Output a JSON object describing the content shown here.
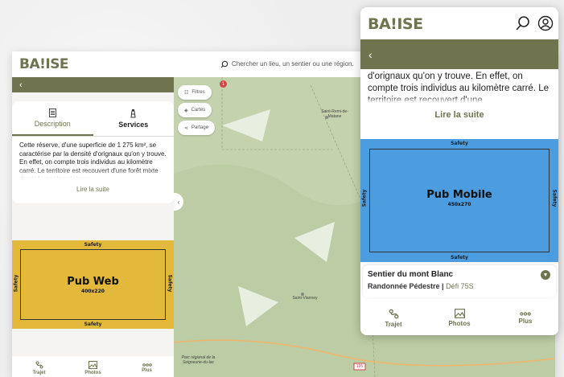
{
  "brand": {
    "logo": "BA!ISE",
    "olive": "#6f744f"
  },
  "desktop": {
    "search_placeholder": "Chercher un lieu, un sentier ou une région...",
    "panel": {
      "back": "‹",
      "tabs": [
        {
          "label": "Description",
          "icon": "document-icon"
        },
        {
          "label": "Services",
          "icon": "lighthouse-icon"
        }
      ],
      "description": "Cette réserve, d'une superficie de 1 275 km², se caractérise par la densité d'orignaux qu'on y trouve. En effet, on compte trois individus au kilomètre carré. Le territoire est recouvert d'une forêt mixte dominée par les résineux.",
      "read_more": "Lire la suite"
    },
    "ad": {
      "title": "Pub Web",
      "size": "400x220",
      "safety": "Safety",
      "color": "#e2b93a"
    },
    "nav": [
      {
        "label": "Trajet",
        "icon": "route-icon"
      },
      {
        "label": "Photos",
        "icon": "image-icon"
      },
      {
        "label": "Plus",
        "icon": "more-icon"
      }
    ],
    "map": {
      "chips": [
        {
          "label": "Filtres",
          "icon": "filter-icon",
          "badge": "1"
        },
        {
          "label": "Cartes",
          "icon": "layers-icon"
        },
        {
          "label": "Partage",
          "icon": "share-icon"
        }
      ],
      "collapse": "‹",
      "labels": [
        "Saint-Remi-de-Matane",
        "Saint-Vianney",
        "Parc régional de la Seigneurie-du-lac",
        "195"
      ]
    }
  },
  "mobile": {
    "back": "‹",
    "description": "d'orignaux qu'on y trouve. En effet, on compte trois individus au kilomètre carré. Le territoire est recouvert d'une",
    "read_more": "Lire la suite",
    "ad": {
      "title": "Pub Mobile",
      "size": "450x270",
      "safety": "Safety",
      "color": "#4c9ce0"
    },
    "trail": {
      "name": "Sentier du mont Blanc",
      "activity": "Randonnée Pédestre",
      "separator": " | ",
      "challenge": "Défi 75S"
    },
    "nav": [
      {
        "label": "Trajet",
        "icon": "route-icon"
      },
      {
        "label": "Photos",
        "icon": "image-icon"
      },
      {
        "label": "Plus",
        "icon": "more-icon"
      }
    ]
  }
}
